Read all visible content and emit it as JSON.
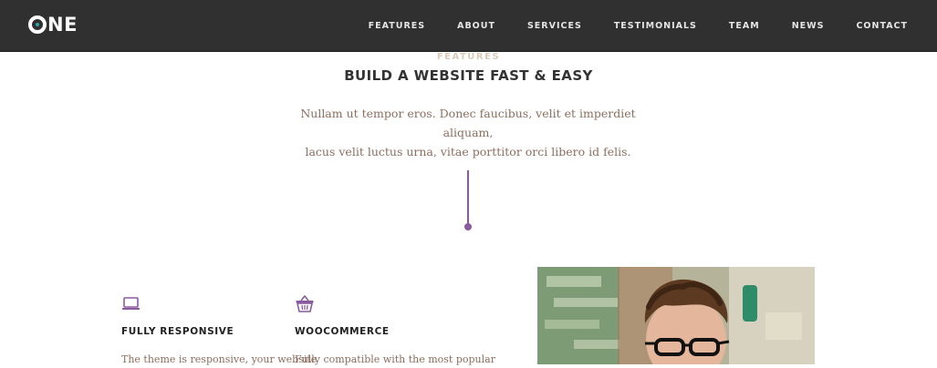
{
  "brand": {
    "logo": "ONE",
    "logo_rest": "NE"
  },
  "nav": {
    "items": [
      {
        "label": "FEATURES"
      },
      {
        "label": "ABOUT"
      },
      {
        "label": "SERVICES"
      },
      {
        "label": "TESTIMONIALS"
      },
      {
        "label": "TEAM"
      },
      {
        "label": "NEWS"
      },
      {
        "label": "CONTACT"
      }
    ]
  },
  "features_section": {
    "kicker": "FEATURES",
    "title": "BUILD A WEBSITE FAST & EASY",
    "lead_line1": "Nullam ut tempor eros. Donec faucibus, velit et imperdiet aliquam,",
    "lead_line2": "lacus velit luctus urna, vitae porttitor orci libero id felis.",
    "accent_color": "#8a5a9e",
    "features": [
      {
        "icon": "laptop-icon",
        "title": "FULLY RESPONSIVE",
        "text": "The theme is responsive, your website"
      },
      {
        "icon": "basket-icon",
        "title": "WOOCOMMERCE",
        "text": "Fully compatible with the most popular"
      }
    ]
  },
  "colors": {
    "navbar_bg": "#303030",
    "kicker": "#d9cbb8",
    "lead_text": "#8b6e5e",
    "title_text": "#333333"
  }
}
